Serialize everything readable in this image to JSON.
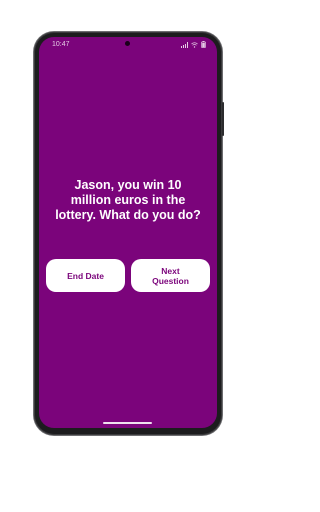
{
  "status_bar": {
    "time": "10:47",
    "icons": [
      "signal-icon",
      "wifi-icon",
      "battery-icon"
    ]
  },
  "question": {
    "text": "Jason, you win 10 million euros in the lottery. What do you do?"
  },
  "buttons": {
    "end_date_label": "End Date",
    "next_question_label": "Next Question"
  },
  "colors": {
    "background": "#7b047b",
    "button_bg": "#ffffff",
    "button_text": "#7b047b",
    "question_text": "#ffffff"
  }
}
